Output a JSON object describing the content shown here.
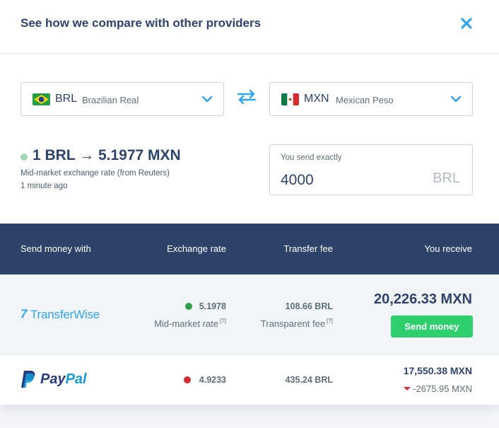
{
  "header": {
    "title": "See how we compare with other providers",
    "close_icon": "close-icon"
  },
  "source_currency": {
    "code": "BRL",
    "name": "Brazilian Real",
    "flag": "brazil-flag"
  },
  "target_currency": {
    "code": "MXN",
    "name": "Mexican Peso",
    "flag": "mexico-flag"
  },
  "swap_icon": "swap-arrows-icon",
  "rate": {
    "text": "1 BRL → 5.1977 MXN",
    "source": "Mid-market exchange rate (from Reuters)",
    "updated": "1 minute ago"
  },
  "amount": {
    "label": "You send exactly",
    "value": "4000",
    "currency": "BRL"
  },
  "table": {
    "headers": {
      "provider": "Send money with",
      "rate": "Exchange rate",
      "fee": "Transfer fee",
      "receive": "You receive"
    },
    "rows": [
      {
        "provider": "TransferWise",
        "rate": "5.1978",
        "rate_note": "Mid-market rate",
        "rate_note_sup": "[?]",
        "fee": "108.66 BRL",
        "fee_note": "Transparent fee",
        "fee_note_sup": "[?]",
        "receive": "20,226.33 MXN",
        "button": "Send money",
        "status_color": "#2e9f4d"
      },
      {
        "provider": "PayPal",
        "rate": "4.9233",
        "fee": "435.24 BRL",
        "receive": "17,550.38 MXN",
        "diff": "-2675.95 MXN",
        "status_color": "#d62b37"
      }
    ]
  },
  "colors": {
    "accent": "#2ea3f2",
    "navy": "#2e4369",
    "green": "#2ed06e",
    "red": "#e02b3b"
  }
}
